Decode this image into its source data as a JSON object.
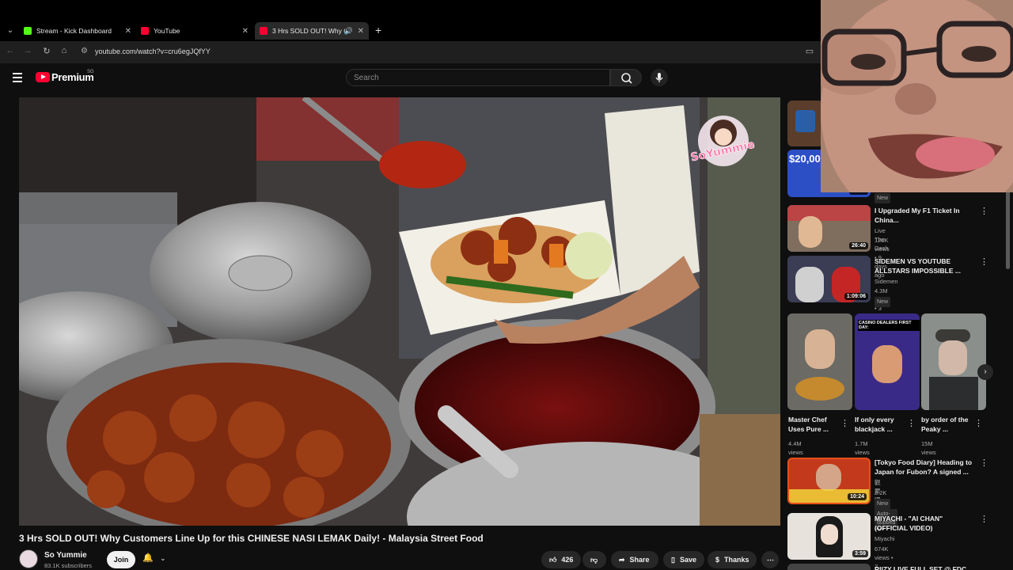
{
  "browser": {
    "tabs": [
      {
        "title": "Stream - Kick Dashboard",
        "color": "#53fc18"
      },
      {
        "title": "YouTube",
        "color": "#ff0033"
      },
      {
        "title": "3 Hrs SOLD OUT! Why Cust",
        "color": "#ff0033"
      }
    ],
    "url": "youtube.com/watch?v=cru6egJQfYY"
  },
  "yt": {
    "brand": "Premium",
    "region": "SG",
    "search_placeholder": "Search"
  },
  "video": {
    "title": "3 Hrs SOLD OUT! Why Customers Line Up for this CHINESE NASI LEMAK Daily! - Malaysia Street Food",
    "watermark": "SoYummie",
    "channel": "So Yummie",
    "subscribers": "83.1K subscribers",
    "join": "Join",
    "likes": "426",
    "share": "Share",
    "save": "Save",
    "thanks": "Thanks"
  },
  "sidebar": {
    "top_thumb_text": "$20,000",
    "top_thumb_duration": "26:44",
    "top_badge": "New",
    "items": [
      {
        "title": "I Upgraded My F1 Ticket In China...",
        "channel": "Live The Dash",
        "meta": "126K views • 9 days ago",
        "duration": "26:40",
        "badge": ""
      },
      {
        "title": "SIDEMEN VS YOUTUBE ALLSTARS IMPOSSIBLE ...",
        "channel": "Sidemen",
        "meta": "4.3M views • 3 days ago",
        "duration": "1:09:06",
        "badge": "New"
      },
      {
        "title": "[Tokyo Food Diary] Heading to Japan for Fubon? A signed ...",
        "channel": "觀眾哪愛看",
        "meta": "2.2K views • 5 days ago",
        "duration": "10:24",
        "badge": "New",
        "badge2": "Auto-dubbed"
      },
      {
        "title": "MIYACHI - \"AI CHAN\" (OFFICIAL VIDEO)",
        "channel": "Miyachi",
        "meta": "674K views • 2 months ago",
        "duration": "3:59",
        "badge": ""
      },
      {
        "title": "RIIZY LIVE FULL SET @ FDC",
        "channel": "",
        "meta": "",
        "duration": "",
        "badge": ""
      }
    ],
    "shorts": [
      {
        "title": "Master Chef Uses Pure ...",
        "views": "4.4M views"
      },
      {
        "title": "If only every blackjack ...",
        "views": "1.7M views",
        "thumb_text": "CASINO DEALERS FIRST DAY:"
      },
      {
        "title": "by order of the Peaky ...",
        "views": "15M views"
      }
    ]
  }
}
